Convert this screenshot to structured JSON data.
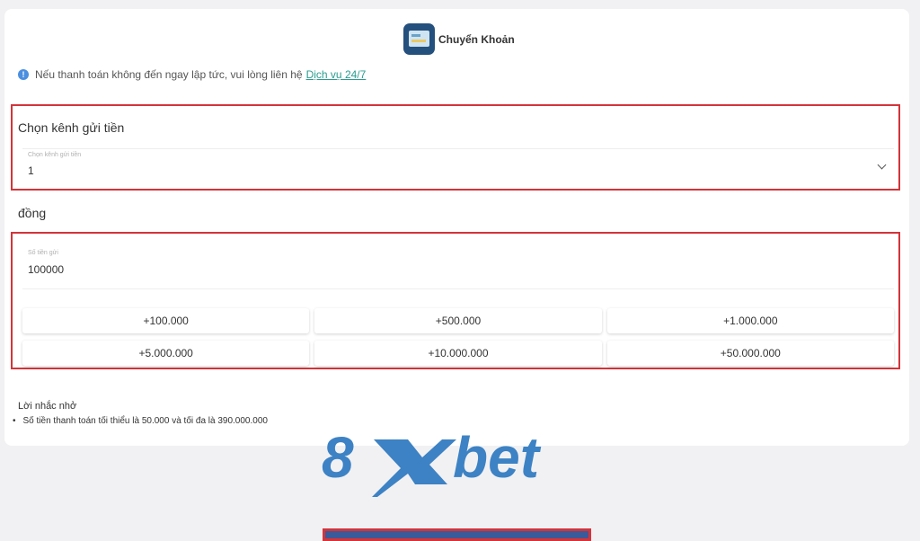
{
  "header": {
    "method_title": "Chuyển Khoản",
    "method_icon": "bank-transfer-icon"
  },
  "notice": {
    "text": "Nếu thanh toán không đến ngay lập tức, vui lòng liên hệ",
    "link_label": "Dịch vụ 24/7",
    "icon": "info-icon"
  },
  "channel": {
    "section_title": "Chọn kênh gửi tiền",
    "select_label": "Chọn kênh gửi tiền",
    "select_value": "1"
  },
  "amount": {
    "currency_label": "đồng",
    "field_label": "Số tiền gửi",
    "field_value": "100000",
    "quick_amounts": [
      "+100.000",
      "+500.000",
      "+1.000.000",
      "+5.000.000",
      "+10.000.000",
      "+50.000.000"
    ]
  },
  "reminder": {
    "title": "Lời nhắc nhở",
    "items": [
      "Số tiền thanh toán tối thiểu là 50.000 và tối đa là 390.000.000"
    ]
  },
  "logo": {
    "text_left": "8",
    "text_x": "X",
    "text_right": "bet"
  },
  "colors": {
    "highlight": "#d3343a",
    "logo_blue": "#3d82c4",
    "link": "#2a9d8f"
  }
}
